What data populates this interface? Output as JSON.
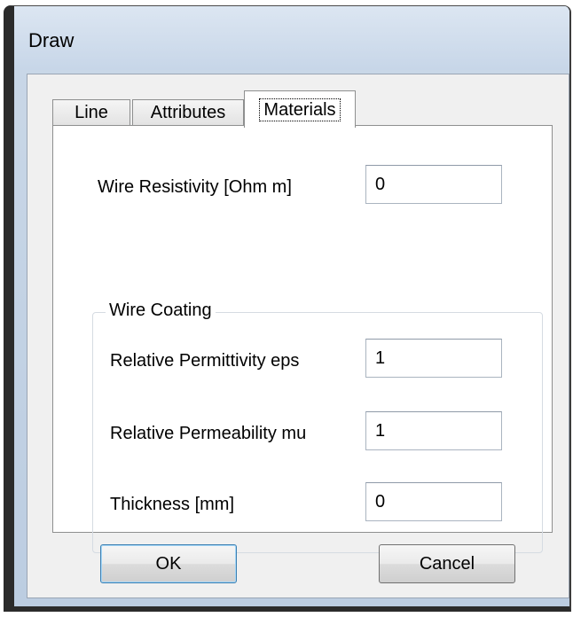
{
  "window": {
    "title": "Draw"
  },
  "tabs": [
    {
      "label": "Line"
    },
    {
      "label": "Attributes"
    },
    {
      "label": "Materials"
    }
  ],
  "materials": {
    "wire_resistivity_label": "Wire Resistivity  [Ohm m]",
    "wire_resistivity_value": "0",
    "coating_group_label": "Wire Coating",
    "permittivity_label": "Relative Permittivity    eps",
    "permittivity_value": "1",
    "permeability_label": "Relative Permeability   mu",
    "permeability_value": "1",
    "thickness_label": "Thickness  [mm]",
    "thickness_value": "0"
  },
  "buttons": {
    "ok_label": "OK",
    "cancel_label": "Cancel"
  }
}
